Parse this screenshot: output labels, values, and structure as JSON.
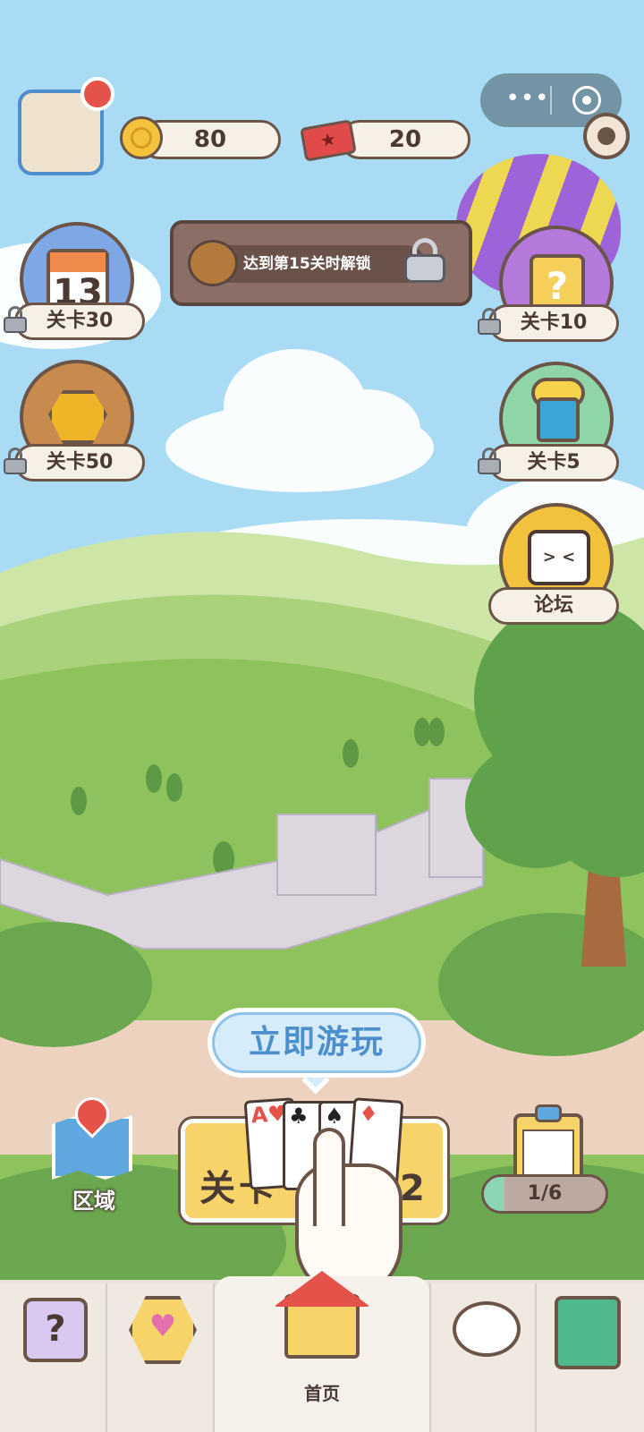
{
  "header": {
    "coins": "80",
    "tickets": "20",
    "ticket_icon": "★"
  },
  "capsule": {
    "more": "•••"
  },
  "locked_banner": {
    "text": "达到第15关时解锁"
  },
  "left_buttons": [
    {
      "label": "关卡30",
      "calendar_day": "13"
    },
    {
      "label": "关卡50"
    }
  ],
  "right_buttons": [
    {
      "label": "关卡10",
      "icon_text": "?"
    },
    {
      "label": "关卡5"
    },
    {
      "label": "论坛",
      "face": "> <"
    }
  ],
  "play": {
    "bubble_label": "立即游玩",
    "level_label": "关卡",
    "level_number": "2",
    "cards": [
      {
        "rank": "A",
        "suit": "♥",
        "color": "#e5524a"
      },
      {
        "rank": "♣",
        "suit": "",
        "color": "#222222"
      },
      {
        "rank": "♠",
        "suit": "",
        "color": "#222222"
      },
      {
        "rank": "♦",
        "suit": "",
        "color": "#e5524a"
      }
    ]
  },
  "region": {
    "label": "区域"
  },
  "tasks": {
    "progress_text": "1/6",
    "progress_fraction": 0.17
  },
  "nav": {
    "home_label": "首页",
    "help_icon_text": "?"
  },
  "colors": {
    "sky": "#a9dcf4",
    "outline": "#6b5448",
    "accent_blue": "#4d8fcc",
    "gold": "#f6d46a"
  }
}
